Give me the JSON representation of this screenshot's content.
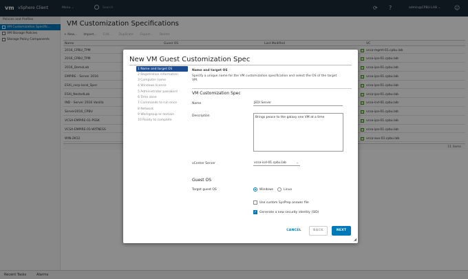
{
  "topbar": {
    "logo": "vm",
    "app_title": "vSphere Client",
    "menu_label": "Menu ⌄",
    "search_placeholder": "Search",
    "user_label": "admin@CPBU.LAB ⌄",
    "icons": [
      "refresh-icon",
      "help-icon",
      "user-icon"
    ]
  },
  "sidebar": {
    "header": "Policies and Profiles",
    "items": [
      {
        "label": "VM Customization Specific...",
        "active": true
      },
      {
        "label": "VM Storage Policies",
        "active": false
      },
      {
        "label": "Storage Policy Components",
        "active": false
      }
    ]
  },
  "main": {
    "title": "VM Customization Specifications",
    "toolbar": [
      "+ New...",
      "Import...",
      "Edit...",
      "Duplicate",
      "Export...",
      "Delete"
    ],
    "columns": [
      "Name",
      "Guest OS",
      "Last Modified",
      "VC"
    ],
    "rows": [
      {
        "name": "2016_CPBU_TPM",
        "vc": "vcsa-mgmt-01.cpbu.lab"
      },
      {
        "name": "2016_CPBU_TPM",
        "vc": "vcsa-ipa-01.cpbu.lab"
      },
      {
        "name": "2016_DemoLab",
        "vc": "vcsa-ipa-01.cpbu.lab"
      },
      {
        "name": "EMPIRE - Server 2016",
        "vc": "vcsa-ipa-01.cpbu.lab"
      },
      {
        "name": "ESXi_corp-local_Spec",
        "vc": "vcsa-ipa-01.cpbu.lab"
      },
      {
        "name": "ESXi_NestedLab",
        "vc": "vcsa-ipa-01.cpbu.lab"
      },
      {
        "name": "IND - Server 2016 Vanilla",
        "vc": "vcsa-ind-01.cpbu.lab"
      },
      {
        "name": "Server2016_CPBU",
        "vc": "vcsa-ipa-01.cpbu.lab"
      },
      {
        "name": "VCSA-EMPIRE-01-PSSK",
        "vc": "vcsa-ipa-01.cpbu.lab"
      },
      {
        "name": "VCSA-EMPIRE-01-WITNESS",
        "vc": "vcsa-ipa-01.cpbu.lab"
      },
      {
        "name": "WIN-2K12",
        "vc": "vcsa-aux-01.cpbu.lab"
      }
    ],
    "footer": "11 items"
  },
  "bottombar": {
    "tabs": [
      "Recent Tasks",
      "Alarms"
    ]
  },
  "modal": {
    "title": "New VM Guest Customization Spec",
    "steps": [
      {
        "label": "1 Name and target OS",
        "active": true
      },
      {
        "label": "2 Registration information",
        "active": false
      },
      {
        "label": "3 Computer name",
        "active": false
      },
      {
        "label": "4 Windows license",
        "active": false
      },
      {
        "label": "5 Administrator password",
        "active": false
      },
      {
        "label": "6 Time zone",
        "active": false
      },
      {
        "label": "7 Commands to run once",
        "active": false
      },
      {
        "label": "8 Network",
        "active": false
      },
      {
        "label": "9 Workgroup or domain",
        "active": false
      },
      {
        "label": "10 Ready to complete",
        "active": false
      }
    ],
    "section_title": "Name and target OS",
    "section_desc": "Specify a unique name for the VM customization specification and select the OS of the target VM.",
    "spec_heading": "VM Customization Spec",
    "name_label": "Name",
    "name_value": "JEDI Server",
    "description_label": "Description",
    "description_value": "Brings peace to the galaxy one VM at a time",
    "vcenter_label": "vCenter Server",
    "vcenter_value": "vcsa-ind-01.cpbu.lab",
    "guest_heading": "Guest OS",
    "target_os_label": "Target guest OS",
    "os_options": [
      {
        "label": "Windows",
        "selected": true
      },
      {
        "label": "Linux",
        "selected": false
      }
    ],
    "sysprep_label": "Use custom SysPrep answer file",
    "sysprep_checked": false,
    "sid_label": "Generate a new security identity (SID)",
    "sid_checked": true,
    "buttons": {
      "cancel": "CANCEL",
      "back": "BACK",
      "next": "NEXT"
    }
  }
}
